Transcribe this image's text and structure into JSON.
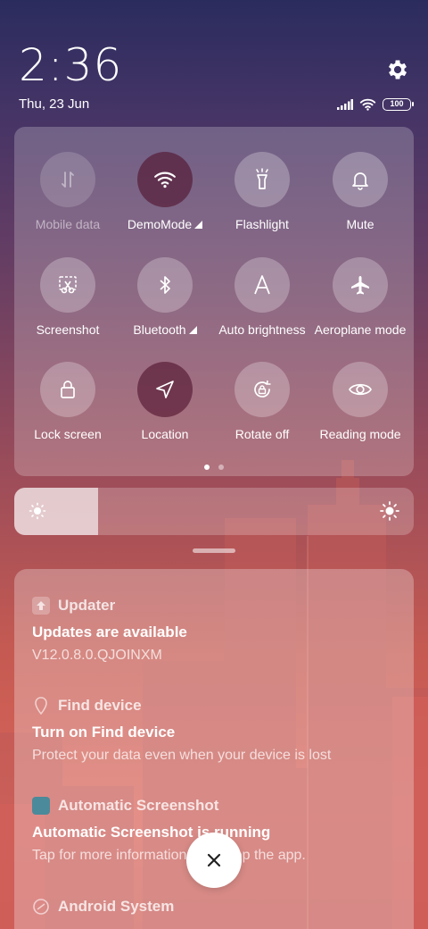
{
  "status": {
    "time": "2:36",
    "date": "Thu, 23 Jun",
    "battery": "100"
  },
  "quick_settings": {
    "tiles": [
      {
        "label": "Mobile data",
        "icon": "mobile-data-icon",
        "state": "disabled"
      },
      {
        "label": "DemoMode",
        "icon": "wifi-icon",
        "state": "active",
        "expandable": true
      },
      {
        "label": "Flashlight",
        "icon": "flashlight-icon",
        "state": "off"
      },
      {
        "label": "Mute",
        "icon": "bell-icon",
        "state": "off"
      },
      {
        "label": "Screenshot",
        "icon": "scissors-icon",
        "state": "off"
      },
      {
        "label": "Bluetooth",
        "icon": "bluetooth-icon",
        "state": "off",
        "expandable": true
      },
      {
        "label": "Auto brightness",
        "icon": "auto-brightness-icon",
        "state": "off"
      },
      {
        "label": "Aeroplane mode",
        "icon": "airplane-icon",
        "state": "off"
      },
      {
        "label": "Lock screen",
        "icon": "lock-icon",
        "state": "off"
      },
      {
        "label": "Location",
        "icon": "location-icon",
        "state": "active"
      },
      {
        "label": "Rotate off",
        "icon": "rotate-lock-icon",
        "state": "off"
      },
      {
        "label": "Reading mode",
        "icon": "eye-icon",
        "state": "off"
      }
    ],
    "page_count": 2,
    "current_page": 1
  },
  "brightness": {
    "level": 0.21
  },
  "notifications": [
    {
      "app": "Updater",
      "title": "Updates are available",
      "text": "V12.0.8.0.QJOINXM"
    },
    {
      "app": "Find device",
      "title": "Turn on Find device",
      "text": "Protect your data even when your device is lost"
    },
    {
      "app": "Automatic Screenshot",
      "title": "Automatic Screenshot is running",
      "text": "Tap for more information or to stop the app."
    },
    {
      "app": "Android System",
      "title": "",
      "text": ""
    }
  ],
  "colors": {
    "active_tile": "#50142d",
    "background_top": "#2b2c5e",
    "background_bottom": "#d9655a"
  }
}
